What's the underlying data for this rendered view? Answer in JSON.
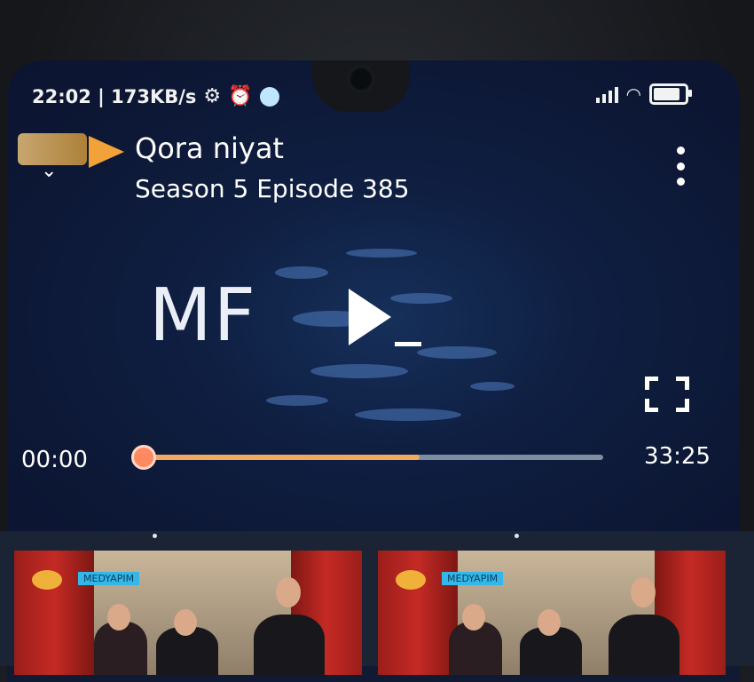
{
  "status_bar": {
    "time_speed": "22:02 | 173KB/s"
  },
  "player": {
    "title": "Qora niyat",
    "subtitle": "Season 5 Episode 385",
    "brand_logo": "MF",
    "time_current": "00:00",
    "time_total": "33:25",
    "buffered_fraction": 0.6,
    "played_fraction": 0.0
  },
  "list": {
    "thumbnails": [
      {
        "badge": "MEDYAPIM"
      },
      {
        "badge": "MEDYAPIM"
      }
    ]
  },
  "colors": {
    "accent": "#f3a23a",
    "seek_thumb": "#ff8a62",
    "background": "#0f1f42"
  }
}
